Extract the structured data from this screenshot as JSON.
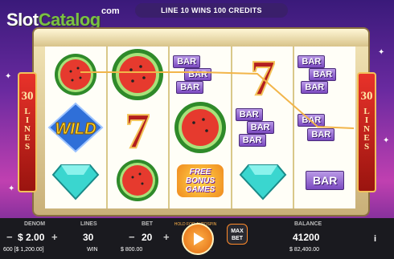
{
  "logo": {
    "slot": "Slot",
    "catalog": "Catalog",
    "com": "com"
  },
  "banner": "LINE 10 WINS 100 CREDITS",
  "side_panels": {
    "left": {
      "number": "30",
      "word": "LINES"
    },
    "right": {
      "number": "30",
      "word": "LINES"
    }
  },
  "reels": [
    [
      "watermelon",
      "wild",
      "diamond"
    ],
    [
      "watermelon",
      "seven",
      "watermelon"
    ],
    [
      "bar-triple",
      "watermelon",
      "free-bonus"
    ],
    [
      "seven",
      "bar-triple",
      "diamond"
    ],
    [
      "bar-triple",
      "bar-double",
      "bar-single"
    ]
  ],
  "symbols": {
    "wild": "WILD",
    "bar": "BAR",
    "free_bonus": "FREE BONUS GAMES",
    "seven": "7"
  },
  "panel": {
    "denom_label": "DENOM",
    "denom_value": "$ 2.00",
    "lines_label": "LINES",
    "lines_value": "30",
    "bet_label": "BET",
    "bet_value": "20",
    "hold_label": "HOLD FOR AUTOSPIN",
    "maxbet_label_1": "MAX",
    "maxbet_label_2": "BET",
    "balance_label": "BALANCE",
    "balance_value": "41200",
    "minus": "−",
    "plus": "+",
    "info": "i"
  },
  "footer": {
    "credits": "600 [$ 1,200.00]",
    "win_label": "WIN",
    "win_value": "$ 800.00",
    "balance_value": "$ 82,400.00"
  },
  "colors": {
    "accent": "#ff8a2a",
    "panel_bg": "#1a1a1f",
    "side_red": "#e8322a",
    "frame": "#f3e6b8"
  }
}
